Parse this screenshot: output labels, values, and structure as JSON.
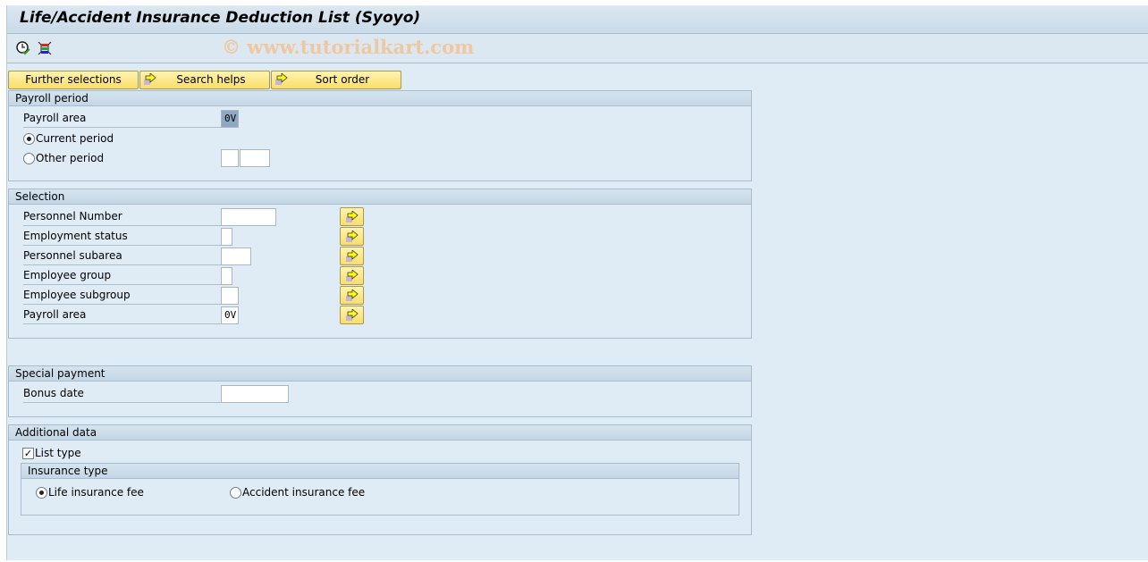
{
  "title": "Life/Accident Insurance Deduction List (Syoyo)",
  "watermark": "© www.tutorialkart.com",
  "toolbar": {
    "icons": [
      "execute-clock-icon",
      "selection-variants-icon"
    ]
  },
  "buttons": {
    "further": "Further selections",
    "search": "Search helps",
    "sort": "Sort order"
  },
  "payroll_period": {
    "header": "Payroll period",
    "payroll_area_label": "Payroll area",
    "payroll_area_value": "0V",
    "current": "Current period",
    "other": "Other period",
    "selected": "current"
  },
  "selection": {
    "header": "Selection",
    "rows": [
      {
        "label": "Personnel Number",
        "value": ""
      },
      {
        "label": "Employment status",
        "value": ""
      },
      {
        "label": "Personnel subarea",
        "value": ""
      },
      {
        "label": "Employee group",
        "value": ""
      },
      {
        "label": "Employee subgroup",
        "value": ""
      },
      {
        "label": "Payroll area",
        "value": "0V"
      }
    ]
  },
  "special": {
    "header": "Special payment",
    "bonus_label": "Bonus date",
    "bonus_value": ""
  },
  "additional": {
    "header": "Additional data",
    "list_type": "List type",
    "list_type_checked": true,
    "ins_header": "Insurance type",
    "life": "Life insurance fee",
    "accident": "Accident insurance fee",
    "selected": "life"
  }
}
